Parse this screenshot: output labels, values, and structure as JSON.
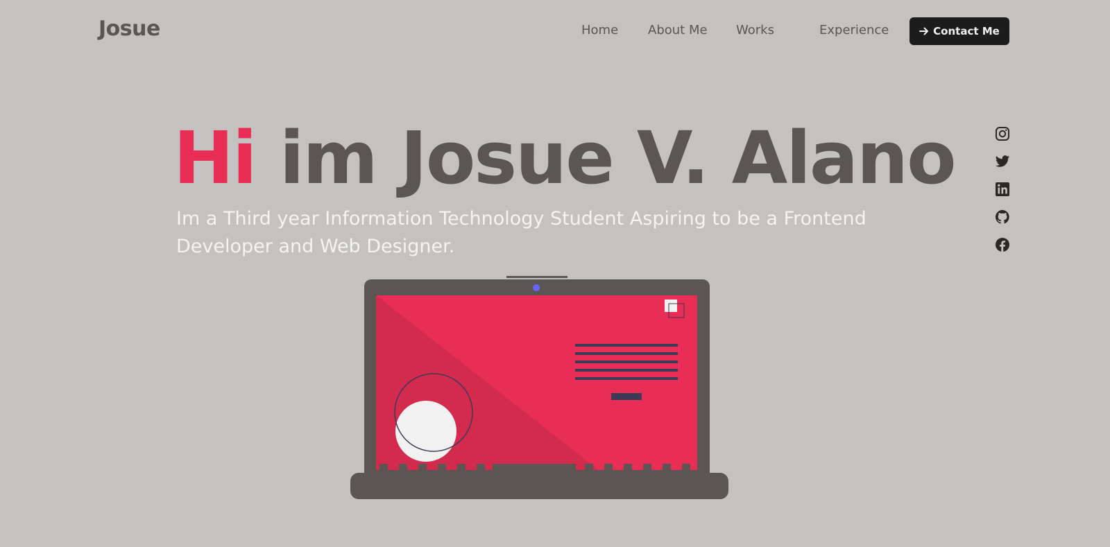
{
  "header": {
    "logo": "Josue",
    "nav": [
      {
        "label": "Home"
      },
      {
        "label": "About Me"
      },
      {
        "label": "Works"
      },
      {
        "label": "Experience"
      }
    ],
    "contact_button": {
      "label": "Contact Me",
      "icon": "arrow-right-icon"
    }
  },
  "hero": {
    "greeting": "Hi",
    "name_line": " im Josue V. Alano",
    "subtitle": "Im a Third year Information Technology Student Aspiring to be a Frontend Developer and Web Designer."
  },
  "social_icons": [
    "instagram-icon",
    "twitter-icon",
    "linkedin-icon",
    "github-icon",
    "facebook-icon"
  ],
  "colors": {
    "background": "#c3c2c0",
    "accent": "#e82e55",
    "text_dark": "#5b5553",
    "button_bg": "#1c1c1c"
  }
}
